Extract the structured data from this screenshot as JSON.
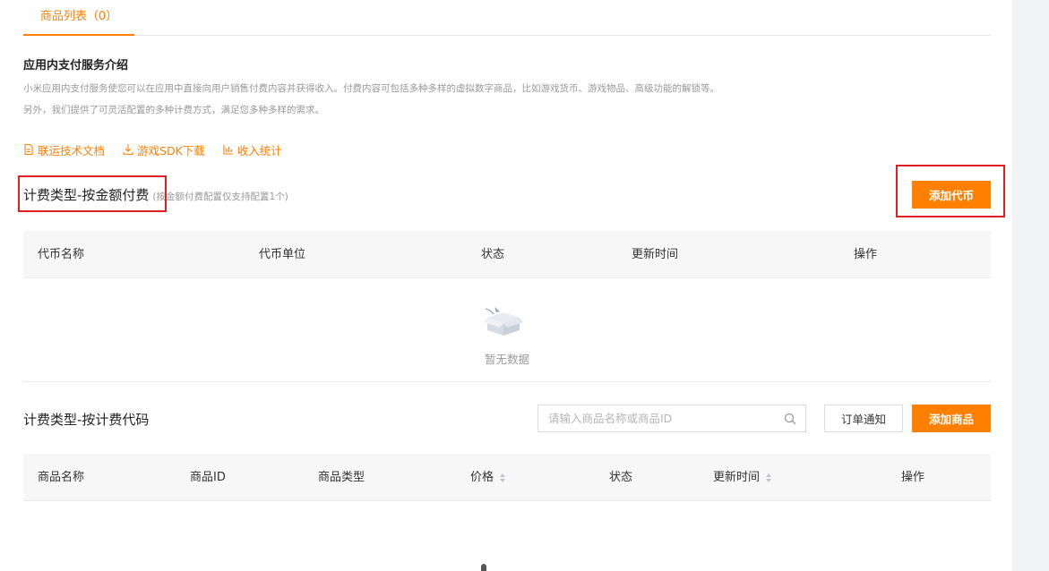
{
  "tabs": [
    {
      "label": "商品列表（0）"
    }
  ],
  "intro": {
    "title": "应用内支付服务介绍",
    "line1": "小米应用内支付服务使您可以在应用中直接向用户销售付费内容并获得收入。付费内容可包括多种多样的虚拟数字商品，比如游戏货币、游戏物品、高级功能的解锁等。",
    "line2": "另外，我们提供了可灵活配置的多种计费方式，满足您多种多样的需求。"
  },
  "links": [
    {
      "label": "联运技术文档",
      "icon": "document-icon"
    },
    {
      "label": "游戏SDK下载",
      "icon": "download-icon"
    },
    {
      "label": "收入统计",
      "icon": "bar-chart-icon"
    }
  ],
  "section_amount": {
    "title": "计费类型-按金额付费",
    "subtitle": "(按金额付费配置仅支持配置1个)",
    "add_button": "添加代币",
    "columns": [
      "代币名称",
      "代币单位",
      "状态",
      "更新时间",
      "操作"
    ],
    "empty_text": "暂无数据"
  },
  "section_code": {
    "title": "计费类型-按计费代码",
    "search_placeholder": "请输入商品名称或商品ID",
    "notify_button": "订单通知",
    "add_button": "添加商品",
    "columns": [
      "商品名称",
      "商品ID",
      "商品类型",
      "价格",
      "状态",
      "更新时间",
      "操作"
    ]
  },
  "colors": {
    "accent": "#ff8000",
    "highlight_box": "#e02020"
  }
}
